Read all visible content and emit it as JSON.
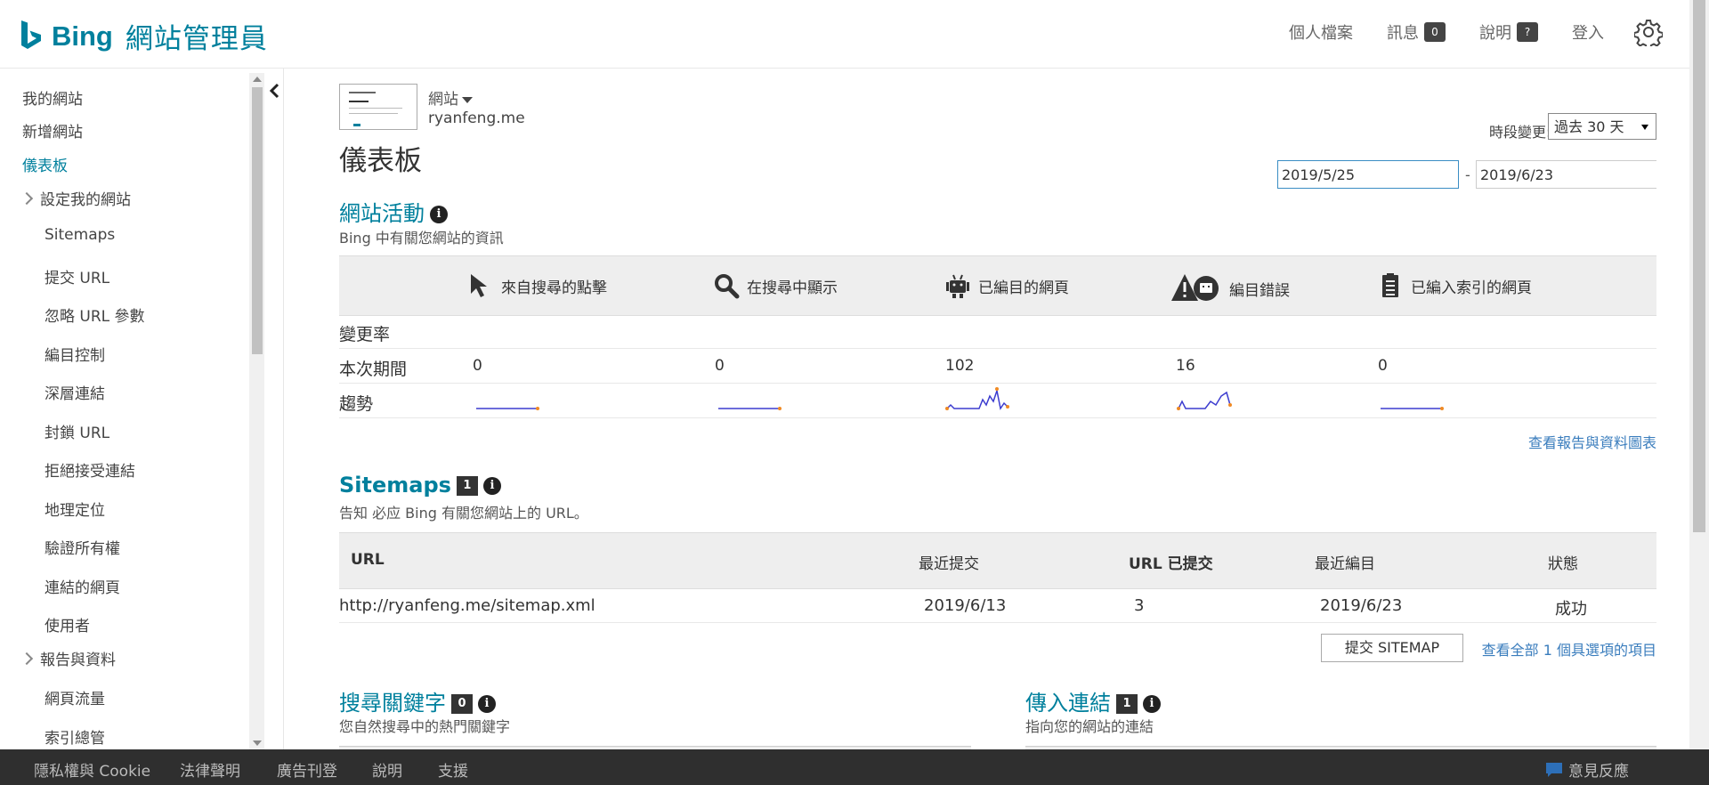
{
  "header": {
    "brand": "Bing",
    "title": "網站管理員",
    "nav": {
      "profile": "個人檔案",
      "messages": "訊息",
      "messages_count": "0",
      "help": "說明",
      "help_badge": "?",
      "login": "登入"
    }
  },
  "sidebar": {
    "items": [
      {
        "label": "我的網站"
      },
      {
        "label": "新增網站"
      },
      {
        "label": "儀表板"
      },
      {
        "label": "設定我的網站"
      },
      {
        "label": "Sitemaps"
      },
      {
        "label": "提交 URL"
      },
      {
        "label": "忽略 URL 參數"
      },
      {
        "label": "編目控制"
      },
      {
        "label": "深層連結"
      },
      {
        "label": "封鎖 URL"
      },
      {
        "label": "拒絕接受連結"
      },
      {
        "label": "地理定位"
      },
      {
        "label": "驗證所有權"
      },
      {
        "label": "連結的網頁"
      },
      {
        "label": "使用者"
      },
      {
        "label": "報告與資料"
      },
      {
        "label": "網頁流量"
      },
      {
        "label": "索引總管"
      }
    ]
  },
  "site": {
    "selector_label": "網站",
    "url": "ryanfeng.me"
  },
  "page_title": "儀表板",
  "period": {
    "label": "時段變更:",
    "selected": "過去 30 天",
    "from": "2019/5/25",
    "to": "2019/6/23",
    "dash": "-"
  },
  "activity": {
    "title": "網站活動",
    "subtitle": "Bing 中有關您網站的資訊",
    "columns": [
      "來自搜尋的點擊",
      "在搜尋中顯示",
      "已編目的網頁",
      "編目錯誤",
      "已編入索引的網頁"
    ],
    "row_change": "變更率",
    "row_current": "本次期間",
    "row_trend": "趨勢",
    "values": [
      "0",
      "0",
      "102",
      "16",
      "0"
    ],
    "report_link": "查看報告與資料圖表"
  },
  "sitemaps": {
    "title": "Sitemaps",
    "count": "1",
    "subtitle": "告知 必应 Bing 有關您網站上的 URL。",
    "headers": [
      "URL",
      "最近提交",
      "URL 已提交",
      "最近編目",
      "狀態"
    ],
    "row": {
      "url": "http://ryanfeng.me/sitemap.xml",
      "submitted": "2019/6/13",
      "urls": "3",
      "crawled": "2019/6/23",
      "status": "成功"
    },
    "submit_button": "提交 SITEMAP",
    "see_all": "查看全部 1 個具選項的項目"
  },
  "keywords": {
    "title": "搜尋關鍵字",
    "count": "0",
    "subtitle": "您自然搜尋中的熱門關鍵字"
  },
  "inbound": {
    "title": "傳入連結",
    "count": "1",
    "subtitle": "指向您的網站的連結"
  },
  "footer": {
    "links": [
      "隱私權與 Cookie",
      "法律聲明",
      "廣告刊登",
      "說明",
      "支援"
    ],
    "feedback": "意見反應"
  },
  "colors": {
    "brand": "#00809d",
    "link": "#3a7dbd",
    "footer_bg": "#2f2f2f"
  }
}
